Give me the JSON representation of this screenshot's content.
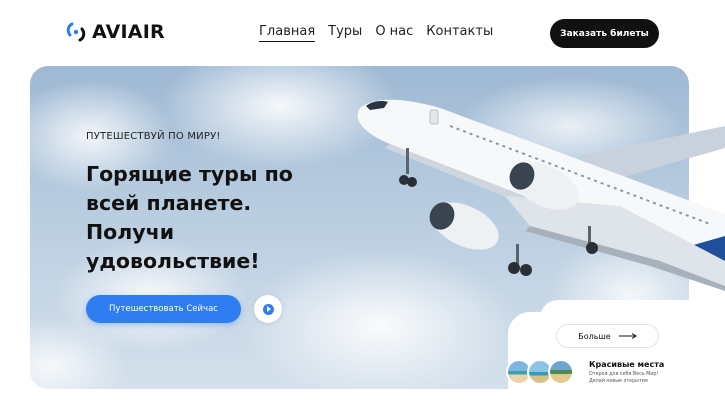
{
  "header": {
    "brand": "AVIAIR",
    "nav": [
      {
        "label": "Главная",
        "active": true
      },
      {
        "label": "Туры",
        "active": false
      },
      {
        "label": "О нас",
        "active": false
      },
      {
        "label": "Контакты",
        "active": false
      }
    ],
    "cta_label": "Заказать билеты"
  },
  "hero": {
    "tagline": "ПУТЕШЕСТВУЙ ПО МИРУ!",
    "headline": "Горящие туры по всей планете. Получи удовольствие!",
    "primary_button": "Путешествовать Сейчас",
    "play_icon": "play-icon"
  },
  "places": {
    "more_label": "Больше",
    "title": "Красивые места",
    "description": "Открой для себя Весь Мир! Делай новые открытия"
  },
  "colors": {
    "accent": "#2f7df0",
    "dark": "#111111"
  }
}
